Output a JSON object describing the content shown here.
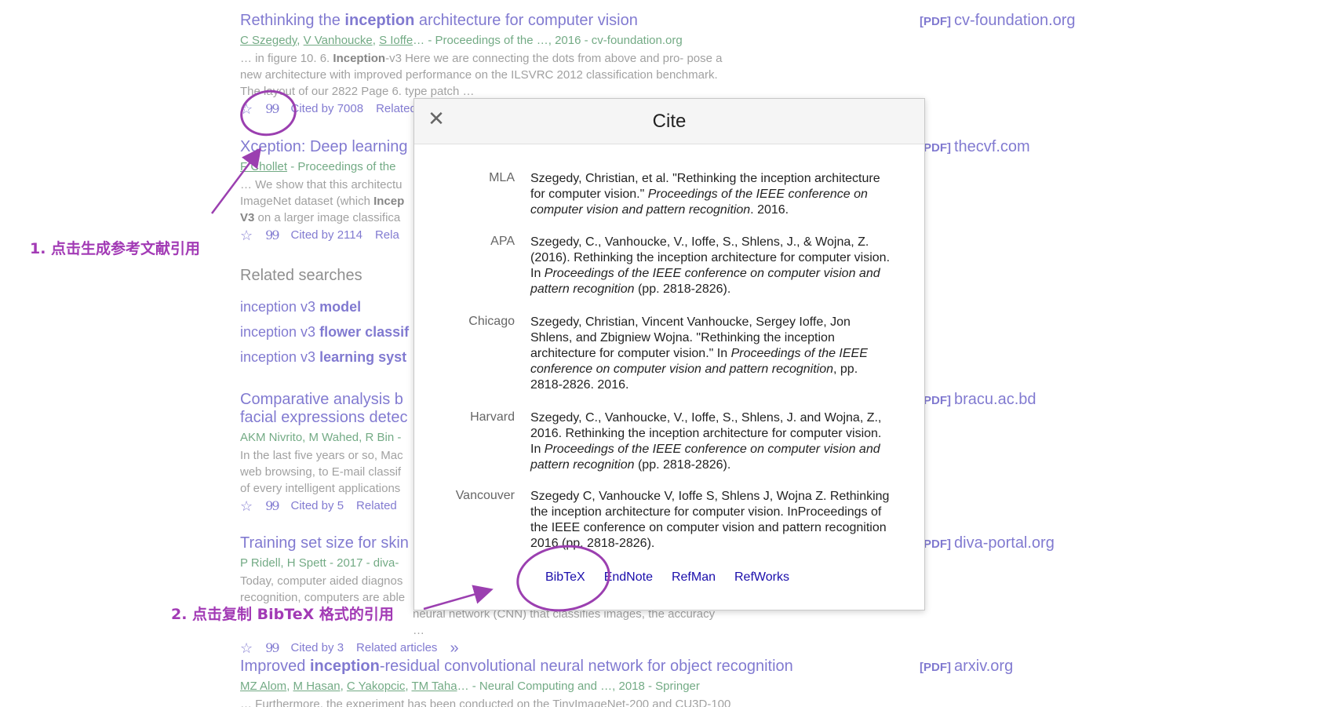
{
  "results": [
    {
      "title_pre": "Rethinking the ",
      "title_bold": "inception",
      "title_post": " architecture for computer vision",
      "authors": [
        "C Szegedy",
        "V Vanhoucke",
        "S Ioffe"
      ],
      "source": "… - Proceedings of the …, 2016 - cv-foundation.org",
      "snippet_pre": "… in figure 10. 6. ",
      "snippet_bold": "Inception",
      "snippet_post": "-v3 Here we are connecting the dots from above and pro- pose a new architecture with improved performance on the ILSVRC 2012 classification benchmark. The layout of our 2822 Page 6. type patch …",
      "cited_by": "Cited by 7008",
      "related": "Related articles",
      "pdf_tag": "[PDF]",
      "pdf_domain": "cv-foundation.org"
    },
    {
      "title": "Xception: Deep learning",
      "authors": "F Chollet",
      "source": " - Proceedings of the",
      "snippet_1": "… We show that this architectu",
      "snippet_2_pre": "ImageNet dataset (which ",
      "snippet_2_bold": "Incep",
      "snippet_3_bold": "V3",
      "snippet_3_post": " on a larger image classifica",
      "cited_by": "Cited by 2114",
      "related": "Rela",
      "pdf_tag": "[PDF]",
      "pdf_domain": "thecvf.com"
    },
    {
      "title_1": "Comparative analysis b",
      "title_2": "facial expressions detec",
      "authors": "AKM Nivrito, M Wahed, R Bin -",
      "snippet_1": "In the last five years or so, Mac",
      "snippet_2": "web browsing, to E-mail classif",
      "snippet_3": "of every intelligent applications",
      "cited_by": "Cited by 5",
      "related": "Related",
      "pdf_tag": "[PDF]",
      "pdf_domain": "bracu.ac.bd"
    },
    {
      "title": "Training set size for skin",
      "authors": "P Ridell, H Spett - 2017 - diva-",
      "snippet_1": "Today, computer aided diagnos",
      "snippet_2": "recognition, computers are able",
      "snippet_3": "neural network (CNN) that classifies images, the accuracy …",
      "cited_by": "Cited by 3",
      "related": "Related articles",
      "pdf_tag": "[PDF]",
      "pdf_domain": "diva-portal.org"
    },
    {
      "title_pre": "Improved ",
      "title_bold": "inception",
      "title_post": "-residual convolutional neural network for object recognition",
      "authors": [
        "MZ Alom",
        "M Hasan",
        "C Yakopcic",
        "TM Taha"
      ],
      "source": "… - Neural Computing and …, 2018 - Springer",
      "snippet": "… Furthermore, the experiment has been conducted on the TinyImageNet-200 and CU3D-100",
      "pdf_tag": "[PDF]",
      "pdf_domain": "arxiv.org"
    }
  ],
  "related_searches": {
    "heading": "Related searches",
    "items": [
      {
        "pre": "inception v3 ",
        "bold": "model"
      },
      {
        "pre": "inception v3 ",
        "bold": "flower classif"
      },
      {
        "pre": "inception v3 ",
        "bold": "learning syst"
      }
    ]
  },
  "modal": {
    "title": "Cite",
    "close_glyph": "✕",
    "citations": [
      {
        "label": "MLA",
        "pre": "Szegedy, Christian, et al. \"Rethinking the inception architecture for computer vision.\" ",
        "ital": "Proceedings of the IEEE conference on computer vision and pattern recognition",
        "post": ". 2016."
      },
      {
        "label": "APA",
        "pre": "Szegedy, C., Vanhoucke, V., Ioffe, S., Shlens, J., & Wojna, Z. (2016). Rethinking the inception architecture for computer vision. In ",
        "ital": "Proceedings of the IEEE conference on computer vision and pattern recognition",
        "post": " (pp. 2818-2826)."
      },
      {
        "label": "Chicago",
        "pre": "Szegedy, Christian, Vincent Vanhoucke, Sergey Ioffe, Jon Shlens, and Zbigniew Wojna. \"Rethinking the inception architecture for computer vision.\" In ",
        "ital": "Proceedings of the IEEE conference on computer vision and pattern recognition",
        "post": ", pp. 2818-2826. 2016."
      },
      {
        "label": "Harvard",
        "pre": "Szegedy, C., Vanhoucke, V., Ioffe, S., Shlens, J. and Wojna, Z., 2016. Rethinking the inception architecture for computer vision. In ",
        "ital": "Proceedings of the IEEE conference on computer vision and pattern recognition",
        "post": " (pp. 2818-2826)."
      },
      {
        "label": "Vancouver",
        "pre": "Szegedy C, Vanhoucke V, Ioffe S, Shlens J, Wojna Z. Rethinking the inception architecture for computer vision. InProceedings of the IEEE conference on computer vision and pattern recognition 2016 (pp. 2818-2826).",
        "ital": "",
        "post": ""
      }
    ],
    "exports": [
      "BibTeX",
      "EndNote",
      "RefMan",
      "RefWorks"
    ]
  },
  "annotations": {
    "step1": "1. 点击生成参考文献引用",
    "step2": "2. 点击复制 BibTeX 格式的引用",
    "color": "#a23ab5"
  },
  "icons": {
    "star": "☆",
    "quote": "99",
    "more": "»"
  }
}
